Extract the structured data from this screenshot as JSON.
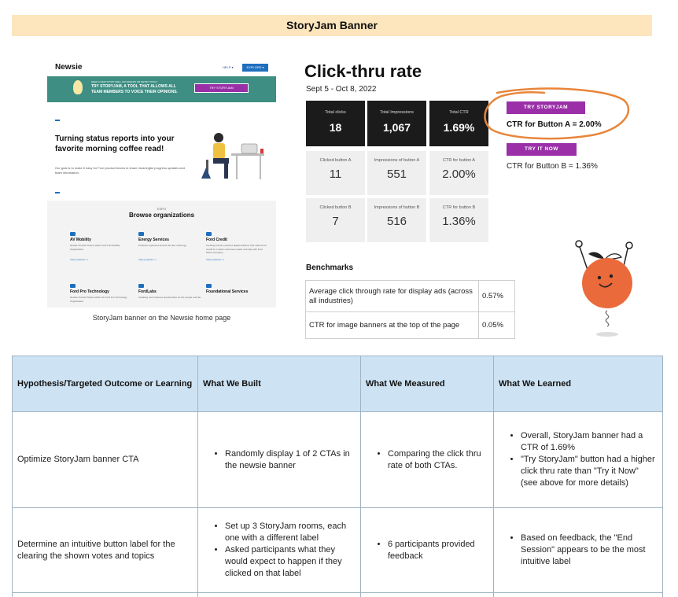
{
  "page": {
    "title": "StoryJam Banner"
  },
  "newsie": {
    "logo": "Newsie",
    "help": "HELP ▾",
    "explore": "EXPLORE ▾",
    "strip_small": "NEED A NEW STORY IDEA, OR DREADS OR RETRO TOOL?",
    "strip_text": "TRY STORYJAM, A TOOL THAT ALLOWS ALL TEAM MEMBERS TO VOICE THEIR OPINIONS.",
    "strip_button": "TRY STORYJAM",
    "hero": "Turning status reports into your favorite morning coffee read!",
    "hero_sub": "Our goal is to make it easy for Ford product teams to share meaningful progress updates and team information.",
    "browse_small": "EXPO",
    "browse_title": "Browse organizations",
    "orgs": [
      {
        "name": "AV Mobility",
        "desc": "Newsie Product Teams within Ford's AV Mobility Organization.",
        "more": "View products >>"
      },
      {
        "name": "Energy Services",
        "desc": "Products organized around the flow of Energy.",
        "more": "View products >>"
      },
      {
        "name": "Ford Credit",
        "desc": "Creating human-centered digital solutions that make Ford Credit to a nation customers easier and stay with Ford Motor Company.",
        "more": "View products >>"
      },
      {
        "name": "Ford Pro Technology",
        "desc": "Newsie Product Teams within the Ford Pro Technology Organization.",
        "more": ""
      },
      {
        "name": "FordLabs",
        "desc": "Updating new business opportunities for the people and the.",
        "more": ""
      },
      {
        "name": "Foundational Services",
        "desc": "",
        "more": ""
      }
    ],
    "caption": "StoryJam banner on the Newsie home page"
  },
  "ctr": {
    "title": "Click-thru rate",
    "date_range": "Sept 5 - Oct 8, 2022",
    "totals": [
      {
        "label": "Total clicks",
        "value": "18"
      },
      {
        "label": "Total Impressions",
        "value": "1,067"
      },
      {
        "label": "Total CTR",
        "value": "1.69%"
      }
    ],
    "button_a": [
      {
        "label": "Clicked button A",
        "value": "11"
      },
      {
        "label": "Impressions of button A",
        "value": "551"
      },
      {
        "label": "CTR for button A",
        "value": "2.00%"
      }
    ],
    "button_b": [
      {
        "label": "Clicked button B",
        "value": "7"
      },
      {
        "label": "Impressions of button B",
        "value": "516"
      },
      {
        "label": "CTR for button B",
        "value": "1.36%"
      }
    ],
    "cta_a_label": "TRY STORYJAM",
    "cta_a_result": "CTR for Button A  = 2.00%",
    "cta_b_label": "TRY IT NOW",
    "cta_b_result": "CTR for Button B = 1.36%",
    "highlight_color": "#e8853a"
  },
  "benchmarks": {
    "title": "Benchmarks",
    "rows": [
      {
        "label": "Average click through rate for display ads (across all industries)",
        "value": "0.57%"
      },
      {
        "label": "CTR for image banners at the top of the page",
        "value": "0.05%"
      }
    ]
  },
  "learning_table": {
    "headers": [
      "Hypothesis/Targeted Outcome or Learning",
      "What We Built",
      "What We Measured",
      "What We Learned"
    ],
    "rows": [
      {
        "hypothesis": "Optimize StoryJam banner CTA",
        "built": [
          "Randomly display 1 of 2 CTAs in the newsie banner"
        ],
        "measured": [
          "Comparing the click thru rate of both CTAs."
        ],
        "learned": [
          "Overall, StoryJam banner had a CTR of 1.69%",
          "\"Try StoryJam\" button had a higher click thru rate than \"Try it Now\" (see above for more details)"
        ]
      },
      {
        "hypothesis": "Determine an intuitive button label for the clearing the shown votes and topics",
        "built": [
          "Set up 3 StoryJam rooms, each one with a different label",
          "Asked participants what they would expect to happen if they clicked on that label"
        ],
        "measured": [
          "6 participants provided feedback"
        ],
        "learned": [
          "Based on feedback, the \"End Session\" appears to be the most intuitive label"
        ]
      }
    ]
  },
  "colors": {
    "banner_bg": "#fde6bd",
    "tile_dark": "#1b1b1b",
    "tile_light": "#efefef",
    "cta_purple": "#9a2fa8",
    "table_header": "#cde3f3",
    "mascot_orange": "#ea6a3c"
  }
}
